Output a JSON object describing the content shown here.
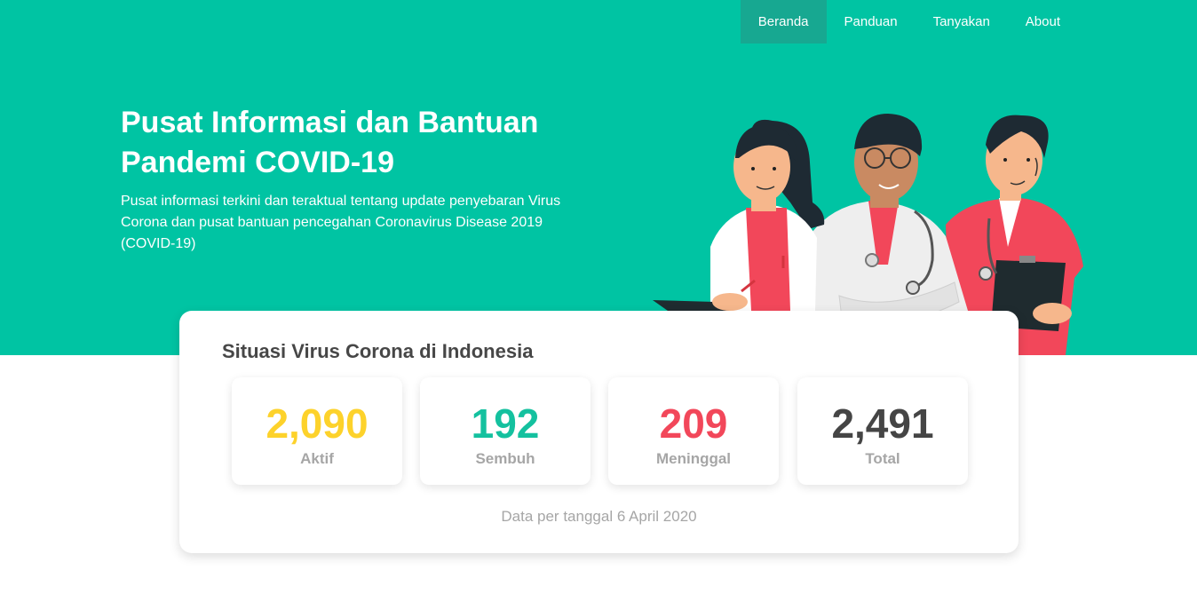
{
  "nav": {
    "items": [
      {
        "label": "Beranda",
        "active": true
      },
      {
        "label": "Panduan"
      },
      {
        "label": "Tanyakan"
      },
      {
        "label": "About"
      }
    ]
  },
  "hero": {
    "title": "Pusat Informasi dan Bantuan Pandemi COVID-19",
    "description": "Pusat informasi terkini dan teraktual tentang update penyebaran Virus Corona dan pusat bantuan pencegahan Coronavirus Disease 2019 (COVID-19)",
    "illustration": "medical-staff-illustration"
  },
  "summary": {
    "title": "Situasi Virus Corona di Indonesia",
    "stats": [
      {
        "value": "2,090",
        "label": "Aktif",
        "color": "#fdd22b"
      },
      {
        "value": "192",
        "label": "Sembuh",
        "color": "#14c19f"
      },
      {
        "value": "209",
        "label": "Meninggal",
        "color": "#f2475a"
      },
      {
        "value": "2,491",
        "label": "Total",
        "color": "#454545"
      }
    ],
    "note": "Data per tanggal 6 April 2020"
  },
  "colors": {
    "brand": "#00c4a3",
    "nav_active": "#17a891"
  }
}
